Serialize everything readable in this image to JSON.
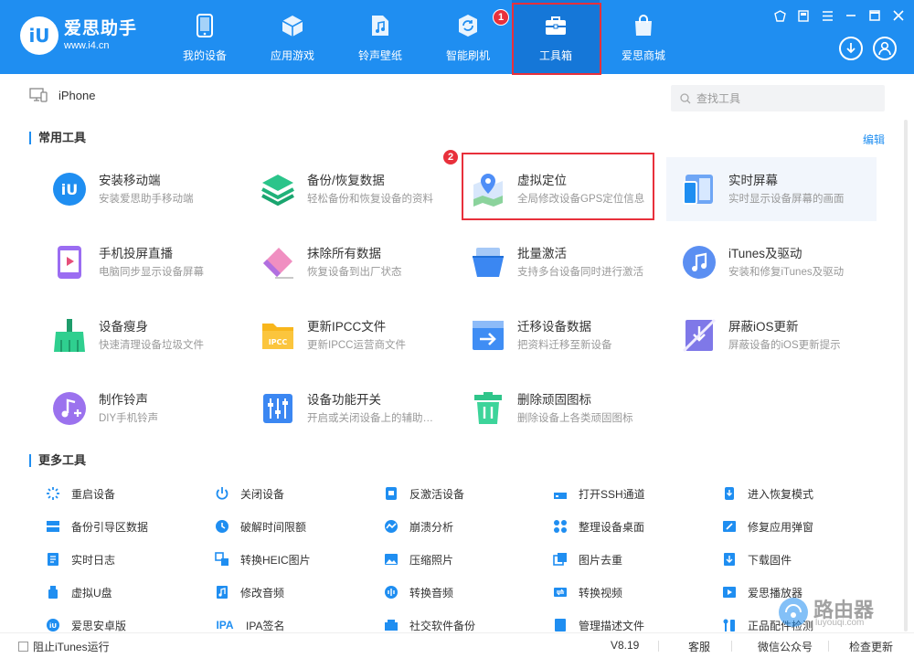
{
  "app": {
    "logo_mark": "iU",
    "name": "爱思助手",
    "url": "www.i4.cn",
    "nav": [
      {
        "label": "我的设备",
        "icon": "phone-icon"
      },
      {
        "label": "应用游戏",
        "icon": "cube-icon"
      },
      {
        "label": "铃声壁纸",
        "icon": "music-file-icon"
      },
      {
        "label": "智能刷机",
        "icon": "refresh-gear-icon"
      },
      {
        "label": "工具箱",
        "icon": "toolbox-icon",
        "active": true
      },
      {
        "label": "爱思商城",
        "icon": "shopping-bag-icon"
      }
    ],
    "step1": "1",
    "step2": "2"
  },
  "device": {
    "name": "iPhone"
  },
  "search": {
    "placeholder": "查找工具"
  },
  "common_tools": {
    "title": "常用工具",
    "edit": "编辑",
    "items": [
      {
        "title": "安装移动端",
        "desc": "安装爱思助手移动端",
        "icon": "i4-app-icon"
      },
      {
        "title": "备份/恢复数据",
        "desc": "轻松备份和恢复设备的资料",
        "icon": "layers-icon"
      },
      {
        "title": "虚拟定位",
        "desc": "全局修改设备GPS定位信息",
        "icon": "map-pin-icon"
      },
      {
        "title": "实时屏幕",
        "desc": "实时显示设备屏幕的画面",
        "icon": "screen-mirror-icon"
      },
      {
        "title": "手机投屏直播",
        "desc": "电脑同步显示设备屏幕",
        "icon": "phone-cast-icon"
      },
      {
        "title": "抹除所有数据",
        "desc": "恢复设备到出厂状态",
        "icon": "eraser-icon"
      },
      {
        "title": "批量激活",
        "desc": "支持多台设备同时进行激活",
        "icon": "batch-activate-icon"
      },
      {
        "title": "iTunes及驱动",
        "desc": "安装和修复iTunes及驱动",
        "icon": "itunes-icon"
      },
      {
        "title": "设备瘦身",
        "desc": "快速清理设备垃圾文件",
        "icon": "broom-icon"
      },
      {
        "title": "更新IPCC文件",
        "desc": "更新IPCC运营商文件",
        "icon": "ipcc-folder-icon"
      },
      {
        "title": "迁移设备数据",
        "desc": "把资料迁移至新设备",
        "icon": "migrate-icon"
      },
      {
        "title": "屏蔽iOS更新",
        "desc": "屏蔽设备的iOS更新提示",
        "icon": "block-update-icon"
      },
      {
        "title": "制作铃声",
        "desc": "DIY手机铃声",
        "icon": "ringtone-icon"
      },
      {
        "title": "设备功能开关",
        "desc": "开启或关闭设备上的辅助…",
        "icon": "sliders-icon"
      },
      {
        "title": "删除顽固图标",
        "desc": "删除设备上各类顽固图标",
        "icon": "trash-icon"
      }
    ]
  },
  "more_tools": {
    "title": "更多工具",
    "items": [
      {
        "label": "重启设备",
        "icon": "restart-icon"
      },
      {
        "label": "关闭设备",
        "icon": "power-icon"
      },
      {
        "label": "反激活设备",
        "icon": "deactivate-icon"
      },
      {
        "label": "打开SSH通道",
        "icon": "ssh-icon"
      },
      {
        "label": "进入恢复模式",
        "icon": "recovery-icon"
      },
      {
        "label": "备份引导区数据",
        "icon": "boot-backup-icon"
      },
      {
        "label": "破解时间限额",
        "icon": "clock-icon"
      },
      {
        "label": "崩溃分析",
        "icon": "crash-analysis-icon"
      },
      {
        "label": "整理设备桌面",
        "icon": "grid-icon"
      },
      {
        "label": "修复应用弹窗",
        "icon": "repair-icon"
      },
      {
        "label": "实时日志",
        "icon": "log-icon"
      },
      {
        "label": "转换HEIC图片",
        "icon": "convert-image-icon"
      },
      {
        "label": "压缩照片",
        "icon": "photo-icon"
      },
      {
        "label": "图片去重",
        "icon": "dedupe-icon"
      },
      {
        "label": "下载固件",
        "icon": "firmware-icon"
      },
      {
        "label": "虚拟U盘",
        "icon": "usb-icon"
      },
      {
        "label": "修改音频",
        "icon": "audio-edit-icon"
      },
      {
        "label": "转换音频",
        "icon": "audio-convert-icon"
      },
      {
        "label": "转换视频",
        "icon": "video-convert-icon"
      },
      {
        "label": "爱思播放器",
        "icon": "player-icon"
      },
      {
        "label": "爱思安卓版",
        "icon": "android-icon"
      },
      {
        "label": "IPA签名",
        "icon": "ipa-icon"
      },
      {
        "label": "社交软件备份",
        "icon": "social-backup-icon"
      },
      {
        "label": "管理描述文件",
        "icon": "profile-icon"
      },
      {
        "label": "正品配件检测",
        "icon": "accessory-check-icon"
      }
    ]
  },
  "footer": {
    "block_itunes": "阻止iTunes运行",
    "version": "V8.19",
    "service": "客服",
    "wechat": "微信公众号",
    "update": "检查更新"
  },
  "watermark": {
    "text": "路由器",
    "sub": "luyouqi.com"
  },
  "colors": {
    "brand": "#1f8ef1",
    "highlight": "#e8303b"
  }
}
